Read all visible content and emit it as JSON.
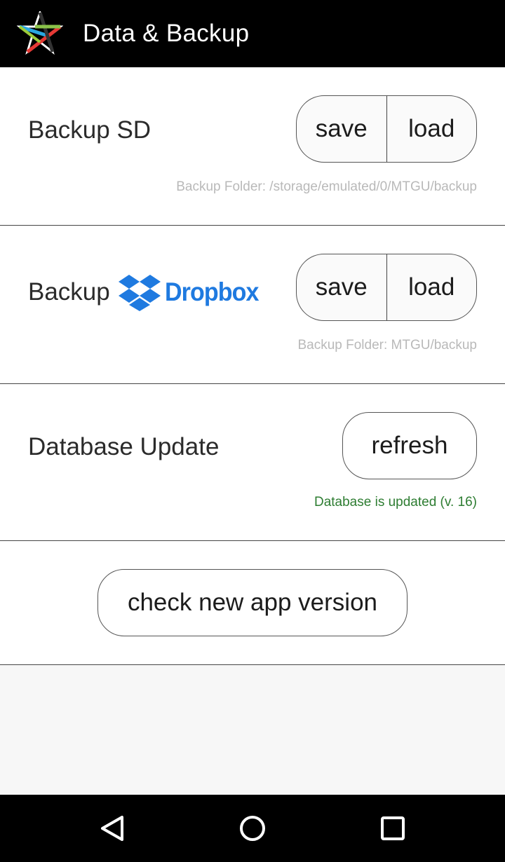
{
  "header": {
    "title": "Data & Backup",
    "logo_icon": "mtgu-star-logo-icon"
  },
  "backup_sd": {
    "title": "Backup SD",
    "save_label": "save",
    "load_label": "load",
    "folder_note": "Backup Folder: /storage/emulated/0/MTGU/backup"
  },
  "backup_dropbox": {
    "title_prefix": "Backup",
    "brand_name": "Dropbox",
    "brand_color": "#1f7ae0",
    "save_label": "save",
    "load_label": "load",
    "folder_note": "Backup Folder: MTGU/backup"
  },
  "database_update": {
    "title": "Database Update",
    "refresh_label": "refresh",
    "status": "Database is updated (v. 16)",
    "status_color": "#2e7d32"
  },
  "app_version": {
    "check_label": "check new app version"
  },
  "nav_bar": {
    "back_icon": "back-icon",
    "home_icon": "home-icon",
    "recents_icon": "recents-icon"
  }
}
